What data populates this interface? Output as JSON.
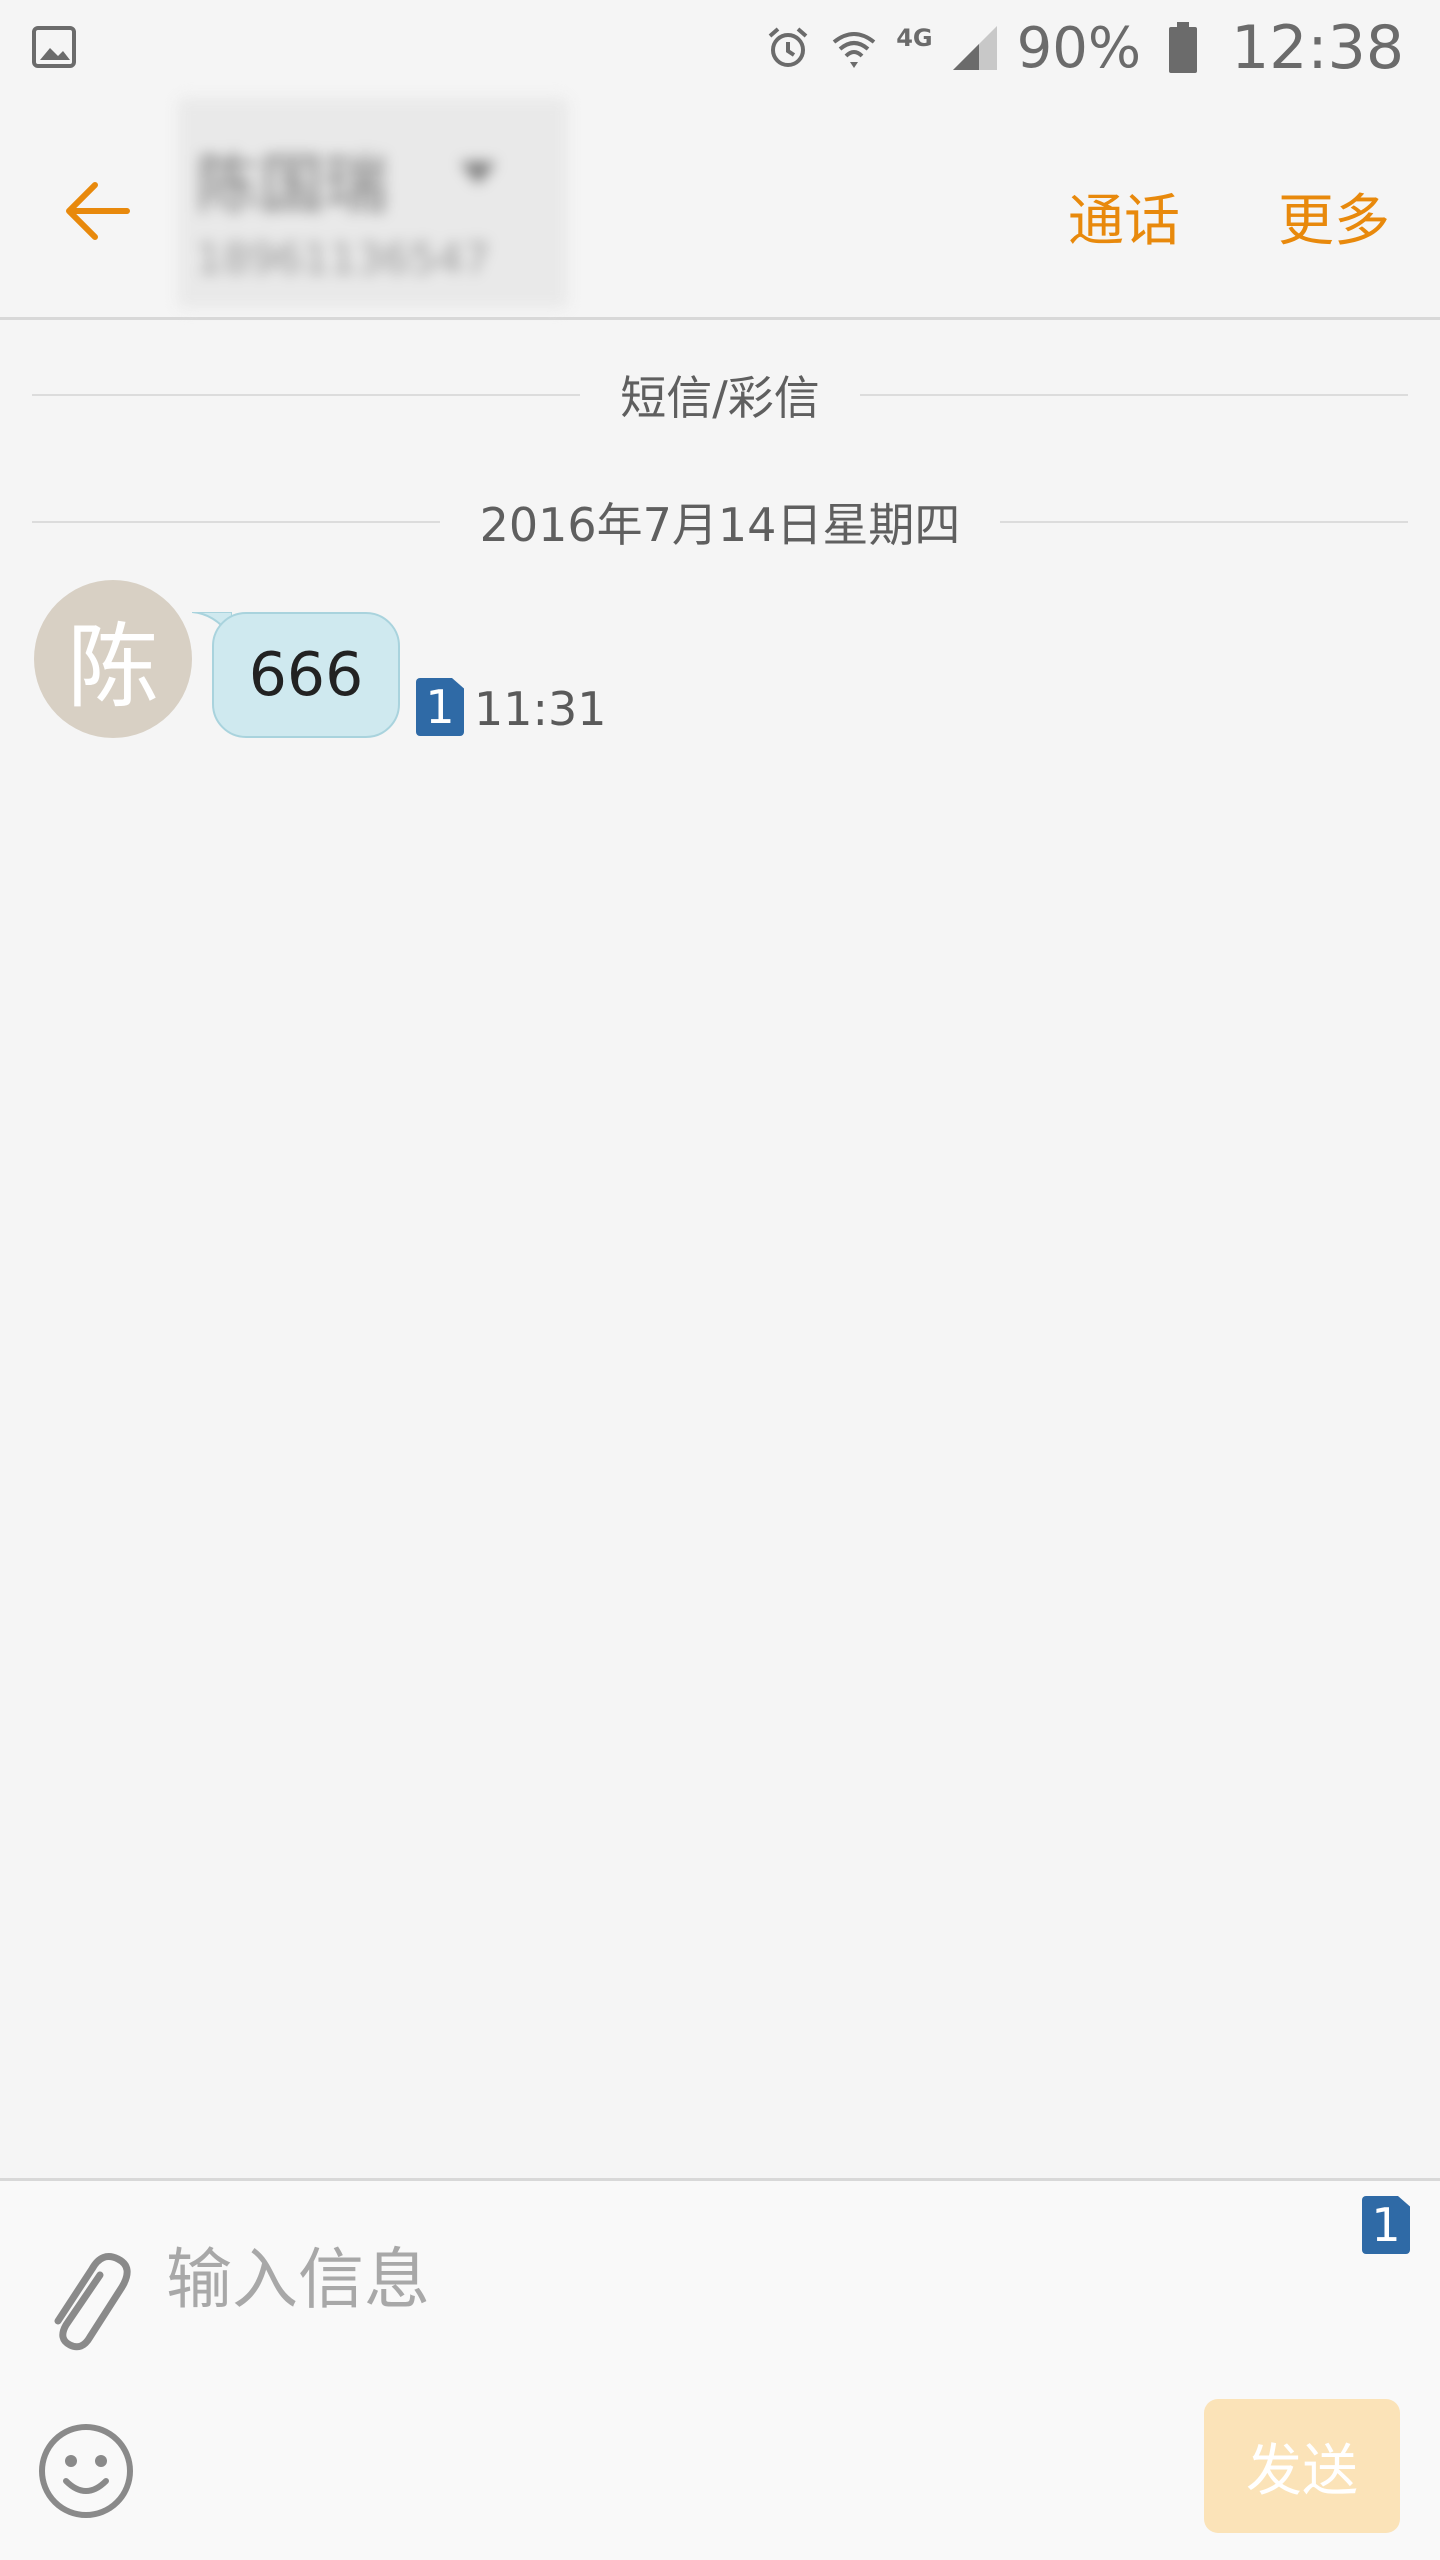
{
  "status_bar": {
    "network_type": "4G",
    "battery_percent": "90%",
    "time": "12:38",
    "icons": [
      "gallery-icon",
      "alarm-icon",
      "wifi-icon",
      "signal-icon",
      "battery-icon"
    ]
  },
  "header": {
    "contact_name": "陈国瑞",
    "contact_number": "18961136547",
    "call_label": "通话",
    "more_label": "更多",
    "accent_color": "#e8890c"
  },
  "conversation": {
    "channel_label": "短信/彩信",
    "date_label": "2016年7月14日星期四",
    "messages": [
      {
        "avatar_initial": "陈",
        "text": "666",
        "sim": "1",
        "time": "11:31"
      }
    ]
  },
  "composer": {
    "placeholder": "输入信息",
    "value": "",
    "send_label": "发送",
    "send_sim": "1"
  }
}
